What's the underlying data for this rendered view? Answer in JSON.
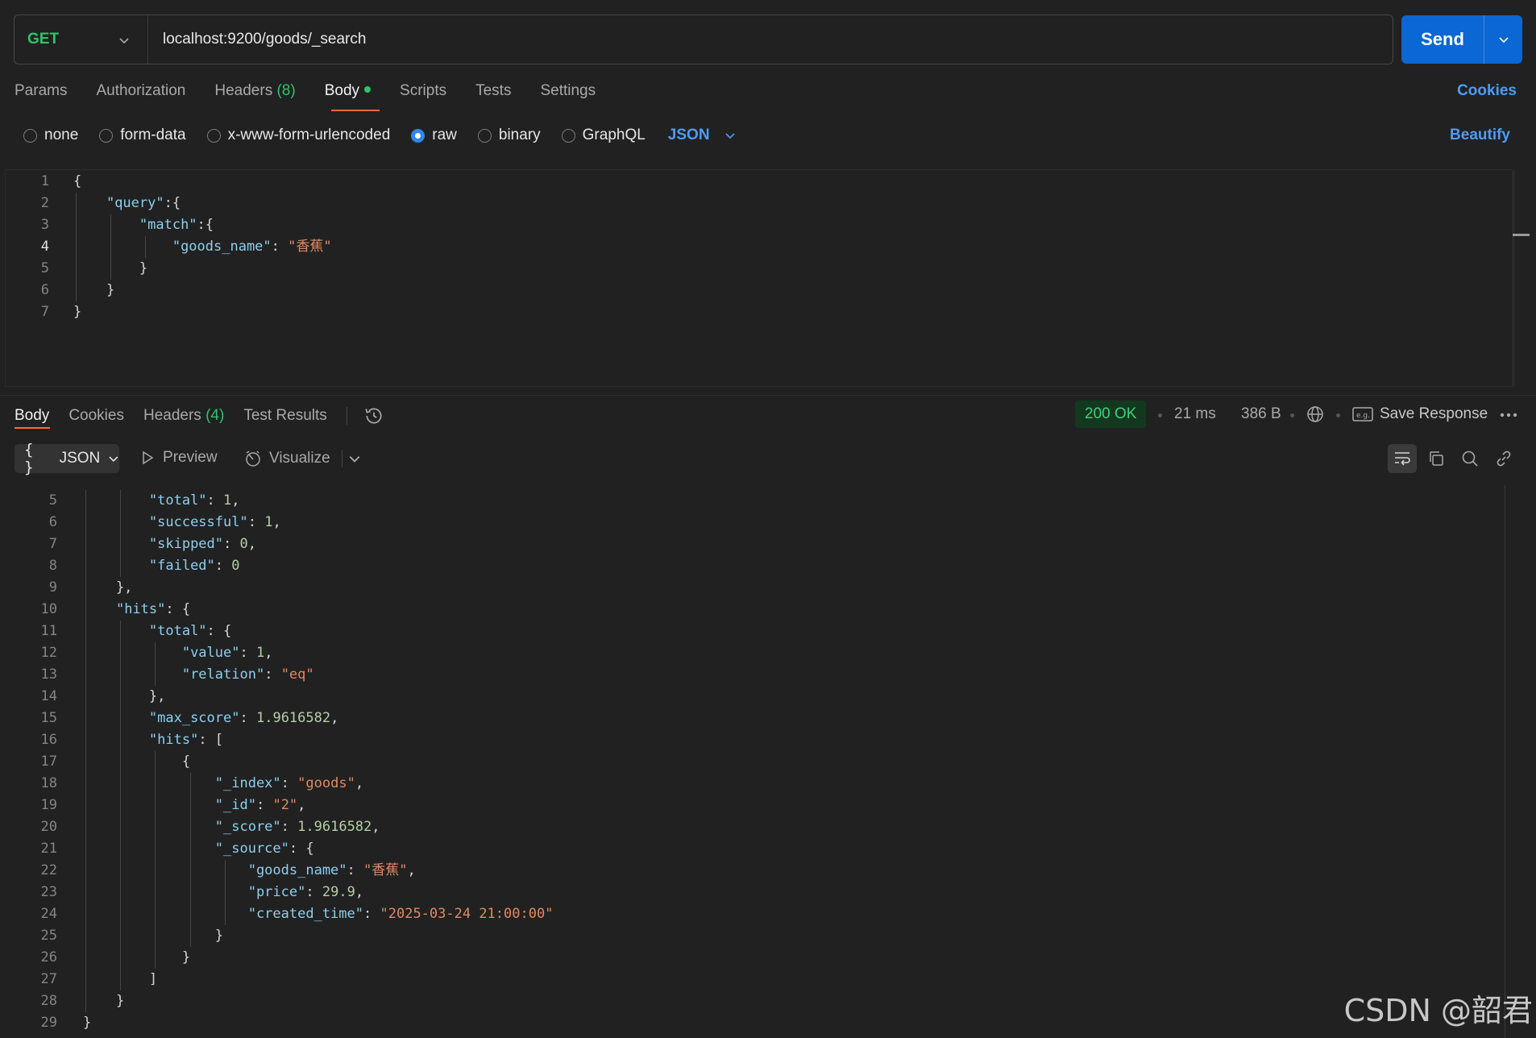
{
  "request": {
    "method": "GET",
    "url": "localhost:9200/goods/_search",
    "send_label": "Send",
    "tabs": {
      "params": "Params",
      "authorization": "Authorization",
      "headers": "Headers",
      "headers_count": "(8)",
      "body": "Body",
      "scripts": "Scripts",
      "tests": "Tests",
      "settings": "Settings"
    },
    "cookies_label": "Cookies",
    "body_types": {
      "none": "none",
      "form_data": "form-data",
      "urlencoded": "x-www-form-urlencoded",
      "raw": "raw",
      "binary": "binary",
      "graphql": "GraphQL"
    },
    "selected_body_type": "raw",
    "raw_format": "JSON",
    "beautify_label": "Beautify",
    "code_lines": [
      {
        "n": "1",
        "text": "{"
      },
      {
        "n": "2",
        "text": "    \"query\":{"
      },
      {
        "n": "3",
        "text": "        \"match\":{"
      },
      {
        "n": "4",
        "text": "            \"goods_name\": \"香蕉\""
      },
      {
        "n": "5",
        "text": "        }"
      },
      {
        "n": "6",
        "text": "    }"
      },
      {
        "n": "7",
        "text": "}"
      }
    ]
  },
  "response": {
    "tabs": {
      "body": "Body",
      "cookies": "Cookies",
      "headers": "Headers",
      "headers_count": "(4)",
      "test_results": "Test Results"
    },
    "status": "200 OK",
    "time": "21 ms",
    "size": "386 B",
    "save_label": "Save Response",
    "format": "JSON",
    "preview_label": "Preview",
    "visualize_label": "Visualize",
    "code_lines": [
      {
        "n": "5",
        "text": "        \"total\": 1,"
      },
      {
        "n": "6",
        "text": "        \"successful\": 1,"
      },
      {
        "n": "7",
        "text": "        \"skipped\": 0,"
      },
      {
        "n": "8",
        "text": "        \"failed\": 0"
      },
      {
        "n": "9",
        "text": "    },"
      },
      {
        "n": "10",
        "text": "    \"hits\": {"
      },
      {
        "n": "11",
        "text": "        \"total\": {"
      },
      {
        "n": "12",
        "text": "            \"value\": 1,"
      },
      {
        "n": "13",
        "text": "            \"relation\": \"eq\""
      },
      {
        "n": "14",
        "text": "        },"
      },
      {
        "n": "15",
        "text": "        \"max_score\": 1.9616582,"
      },
      {
        "n": "16",
        "text": "        \"hits\": ["
      },
      {
        "n": "17",
        "text": "            {"
      },
      {
        "n": "18",
        "text": "                \"_index\": \"goods\","
      },
      {
        "n": "19",
        "text": "                \"_id\": \"2\","
      },
      {
        "n": "20",
        "text": "                \"_score\": 1.9616582,"
      },
      {
        "n": "21",
        "text": "                \"_source\": {"
      },
      {
        "n": "22",
        "text": "                    \"goods_name\": \"香蕉\","
      },
      {
        "n": "23",
        "text": "                    \"price\": 29.9,"
      },
      {
        "n": "24",
        "text": "                    \"created_time\": \"2025-03-24 21:00:00\""
      },
      {
        "n": "25",
        "text": "                }"
      },
      {
        "n": "26",
        "text": "            }"
      },
      {
        "n": "27",
        "text": "        ]"
      },
      {
        "n": "28",
        "text": "    }"
      },
      {
        "n": "29",
        "text": "}"
      }
    ]
  },
  "watermark": "CSDN @韶君"
}
